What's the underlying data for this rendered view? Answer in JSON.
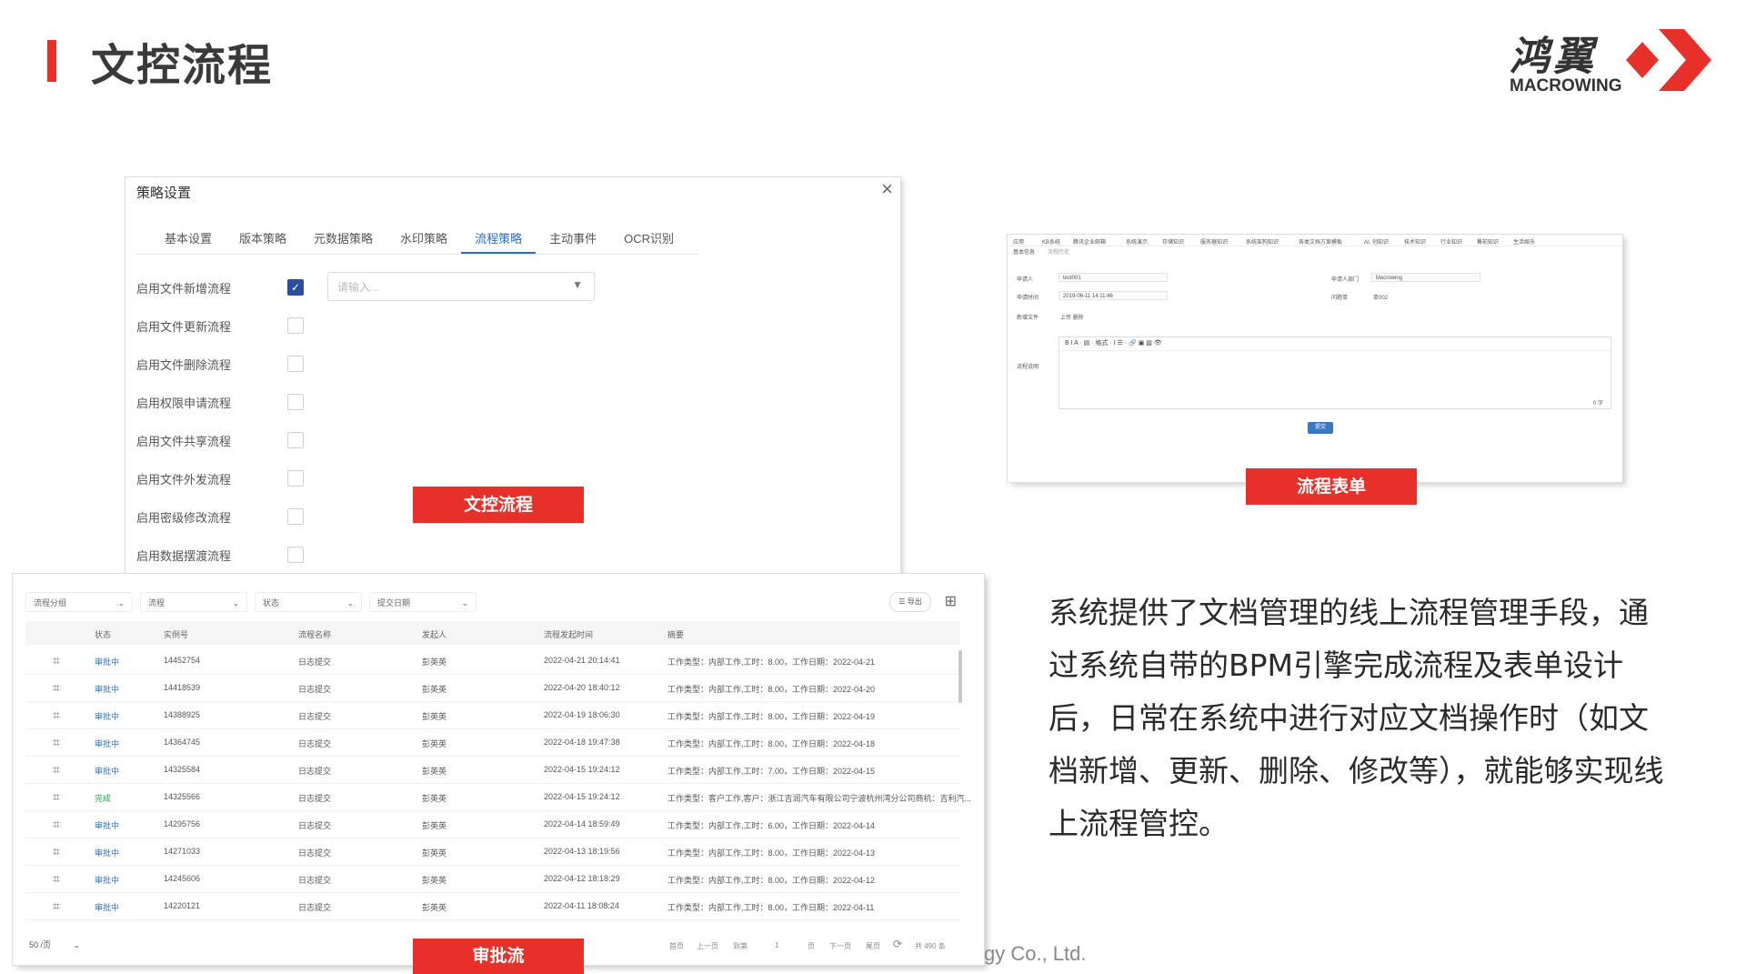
{
  "header": {
    "title": "文控流程"
  },
  "logo": {
    "cn": "鸿翼",
    "en": "MACROWING"
  },
  "policy": {
    "title": "策略设置",
    "close": "×",
    "tabs": [
      "基本设置",
      "版本策略",
      "元数据策略",
      "水印策略",
      "流程策略",
      "主动事件",
      "OCR识别"
    ],
    "active_tab": "流程策略",
    "options": [
      "启用文件新增流程",
      "启用文件更新流程",
      "启用文件删除流程",
      "启用权限申请流程",
      "启用文件共享流程",
      "启用文件外发流程",
      "启用密级修改流程",
      "启用数据摆渡流程"
    ],
    "checked": [
      true,
      false,
      false,
      false,
      false,
      false,
      false,
      false
    ],
    "select_placeholder": "请输入...",
    "badge": "文控流程"
  },
  "form": {
    "badge": "流程表单",
    "toolbar": [
      "应用",
      "KB系统",
      "腾讯企业邮箱",
      "系统演示",
      "存储知识",
      "服务器知识",
      "系统架构知识",
      "各类文档方案模板",
      "AI, 创知识",
      "技术知识",
      "行业知识",
      "售前知识",
      "生活娱乐"
    ],
    "tabs": [
      "基本信息",
      "流程历史"
    ],
    "fields": {
      "applicant_label": "申请人",
      "applicant": "test001",
      "dept_label": "申请人部门",
      "dept": "Macrowing",
      "time_label": "申请时间",
      "time": "2019-06-11 14:11:46",
      "no_label": "问题单",
      "no": "单002",
      "file_label": "新增文件",
      "file_actions": "上传  删除",
      "desc_label": "流程说明"
    },
    "editor_toolbar": "B  I  A ·  ▤ ·  格式 ·  I  ☰ ·  🔗  ▣  ▨  👁",
    "editor_count": "0 字",
    "submit": "提交"
  },
  "list": {
    "badge": "审批流",
    "filters": [
      "流程分组",
      "流程",
      "状态",
      "提交日期"
    ],
    "export": "导出",
    "columns": [
      "状态",
      "实例号",
      "流程名称",
      "发起人",
      "流程发起时间",
      "摘要"
    ],
    "rows": [
      {
        "status": "审批中",
        "id": "14452754",
        "name": "日志提交",
        "by": "彭英英",
        "time": "2022-04-21 20:14:41",
        "summary": "工作类型：内部工作,工时：8.00，工作日期：2022-04-21"
      },
      {
        "status": "审批中",
        "id": "14418539",
        "name": "日志提交",
        "by": "彭英英",
        "time": "2022-04-20 18:40:12",
        "summary": "工作类型：内部工作,工时：8.00，工作日期：2022-04-20"
      },
      {
        "status": "审批中",
        "id": "14388925",
        "name": "日志提交",
        "by": "彭英英",
        "time": "2022-04-19 18:06:30",
        "summary": "工作类型：内部工作,工时：8.00，工作日期：2022-04-19"
      },
      {
        "status": "审批中",
        "id": "14364745",
        "name": "日志提交",
        "by": "彭英英",
        "time": "2022-04-18 19:47:38",
        "summary": "工作类型：内部工作,工时：8.00，工作日期：2022-04-18"
      },
      {
        "status": "审批中",
        "id": "14325584",
        "name": "日志提交",
        "by": "彭英英",
        "time": "2022-04-15 19:24:12",
        "summary": "工作类型：内部工作,工时：7.00，工作日期：2022-04-15"
      },
      {
        "status": "完成",
        "id": "14325566",
        "name": "日志提交",
        "by": "彭英英",
        "time": "2022-04-15 19:24:12",
        "summary": "工作类型：客户工作,客户：浙江吉润汽车有限公司宁波杭州湾分公司商机：吉利汽..."
      },
      {
        "status": "审批中",
        "id": "14295756",
        "name": "日志提交",
        "by": "彭英英",
        "time": "2022-04-14 18:59:49",
        "summary": "工作类型：内部工作,工时：6.00，工作日期：2022-04-14"
      },
      {
        "status": "审批中",
        "id": "14271033",
        "name": "日志提交",
        "by": "彭英英",
        "time": "2022-04-13 18:19:56",
        "summary": "工作类型：内部工作,工时：8.00，工作日期：2022-04-13"
      },
      {
        "status": "审批中",
        "id": "14245606",
        "name": "日志提交",
        "by": "彭英英",
        "time": "2022-04-12 18:18:29",
        "summary": "工作类型：内部工作,工时：8.00，工作日期：2022-04-12"
      },
      {
        "status": "审批中",
        "id": "14220121",
        "name": "日志提交",
        "by": "彭英英",
        "time": "2022-04-11 18:08:24",
        "summary": "工作类型：内部工作,工时：8.00，工作日期：2022-04-11"
      }
    ],
    "page_size": "50 /页",
    "pager": {
      "first": "首页",
      "prev": "上一页",
      "goto": "到第",
      "page": "1",
      "page_unit": "页",
      "next": "下一页",
      "last": "尾页",
      "total": "共 490 条"
    }
  },
  "description": "系统提供了文档管理的线上流程管理手段，通过系统自带的BPM引擎完成流程及表单设计后，日常在系统中进行对应文档操作时（如文档新增、更新、删除、修改等），就能够实现线上流程管控。",
  "footer": "gy Co., Ltd.",
  "colors": {
    "accent": "#e8302a",
    "link": "#2d73c9",
    "done": "#2fa34a"
  }
}
